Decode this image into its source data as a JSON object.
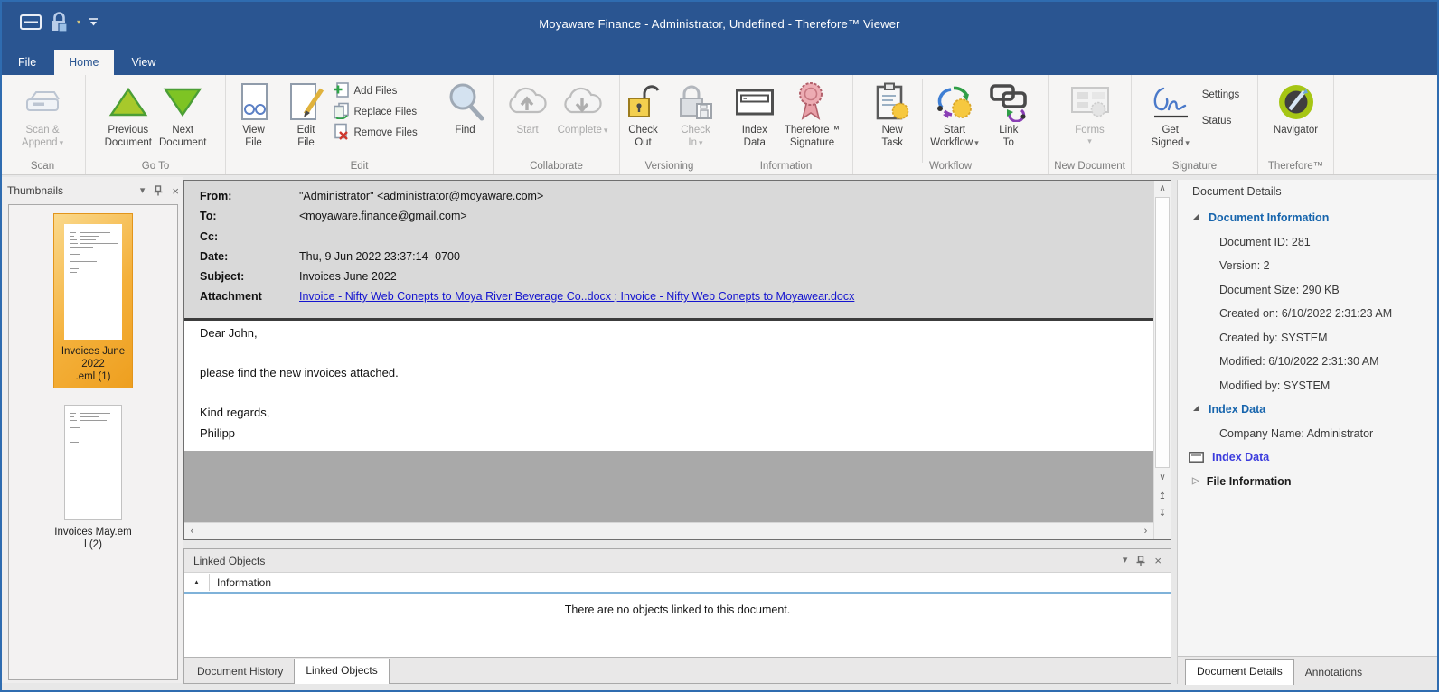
{
  "colors": {
    "titlebar_blue": "#2a5591",
    "ribbon_bg": "#f6f5f4",
    "selection_orange": "#f2a33c",
    "link_blue": "#1414cf",
    "section_header_blue": "#1765ad",
    "index_link_blue": "#3b3bdd",
    "email_header_gray": "#d9d9d9",
    "content_gray": "#a9a9a9",
    "col_underline_blue": "#7fb2d9"
  },
  "titlebar": {
    "title": "Moyaware Finance - Administrator, Undefined - Therefore™ Viewer"
  },
  "tabs": {
    "file": "File",
    "home": "Home",
    "view": "View"
  },
  "ribbon": {
    "groups": [
      {
        "label": "Scan",
        "buttons": [
          {
            "label": "Scan &\nAppend"
          }
        ]
      },
      {
        "label": "Go To",
        "buttons": [
          {
            "label": "Previous\nDocument"
          },
          {
            "label": "Next\nDocument"
          }
        ]
      },
      {
        "label": "Edit",
        "buttons": [
          {
            "label": "View\nFile"
          },
          {
            "label": "Edit\nFile"
          },
          {
            "label": "Add Files"
          },
          {
            "label": "Replace Files"
          },
          {
            "label": "Remove Files"
          },
          {
            "label": "Find"
          }
        ]
      },
      {
        "label": "Collaborate",
        "buttons": [
          {
            "label": "Start"
          },
          {
            "label": "Complete"
          }
        ]
      },
      {
        "label": "Versioning",
        "buttons": [
          {
            "label": "Check\nOut"
          },
          {
            "label": "Check\nIn"
          }
        ]
      },
      {
        "label": "Information",
        "buttons": [
          {
            "label": "Index\nData"
          },
          {
            "label": "Therefore™\nSignature"
          }
        ]
      },
      {
        "label": "Workflow",
        "buttons": [
          {
            "label": "New\nTask"
          },
          {
            "label": "Start\nWorkflow"
          },
          {
            "label": "Link\nTo"
          }
        ]
      },
      {
        "label": "New Document",
        "buttons": [
          {
            "label": "Forms"
          }
        ]
      },
      {
        "label": "Signature",
        "buttons": [
          {
            "label": "Get\nSigned"
          },
          {
            "label": "Settings"
          },
          {
            "label": "Status"
          }
        ]
      },
      {
        "label": "Therefore™",
        "buttons": [
          {
            "label": "Navigator"
          }
        ]
      }
    ]
  },
  "thumbnails": {
    "header": "Thumbnails",
    "items": [
      {
        "label": "Invoices June 2022\n.eml (1)",
        "selected": true
      },
      {
        "label": "Invoices May.em\nl (2)",
        "selected": false
      }
    ]
  },
  "email": {
    "fields": [
      {
        "label": "From:",
        "value": "\"Administrator\" <administrator@moyaware.com>"
      },
      {
        "label": "To:",
        "value": "<moyaware.finance@gmail.com>"
      },
      {
        "label": "Cc:",
        "value": ""
      },
      {
        "label": "Date:",
        "value": "Thu, 9 Jun 2022 23:37:14 -0700"
      },
      {
        "label": "Subject:",
        "value": "Invoices June 2022"
      },
      {
        "label": "Attachment",
        "value": "Invoice - Nifty Web Conepts to Moya River Beverage Co..docx ; Invoice - Nifty Web Conepts to Moyawear.docx"
      }
    ],
    "body": [
      "Dear John,",
      "please find the new invoices attached.",
      "Kind regards,",
      "Philipp"
    ]
  },
  "linked_objects": {
    "title": "Linked Objects",
    "column": "Information",
    "empty_message": "There are no objects linked to this document.",
    "tabs": [
      "Document History",
      "Linked Objects"
    ]
  },
  "details": {
    "title": "Document Details",
    "doc_info_header": "Document Information",
    "doc_info_rows": [
      "Document ID: 281",
      "Version: 2",
      "Document Size: 290 KB",
      "Created on: 6/10/2022 2:31:23 AM",
      "Created by: SYSTEM",
      "Modified: 6/10/2022 2:31:30 AM",
      "Modified by: SYSTEM"
    ],
    "index_data_header": "Index Data",
    "index_rows": [
      "Company Name:  Administrator"
    ],
    "index_data_link": "Index Data",
    "file_info_header": "File Information",
    "tabs": [
      "Document Details",
      "Annotations"
    ]
  }
}
